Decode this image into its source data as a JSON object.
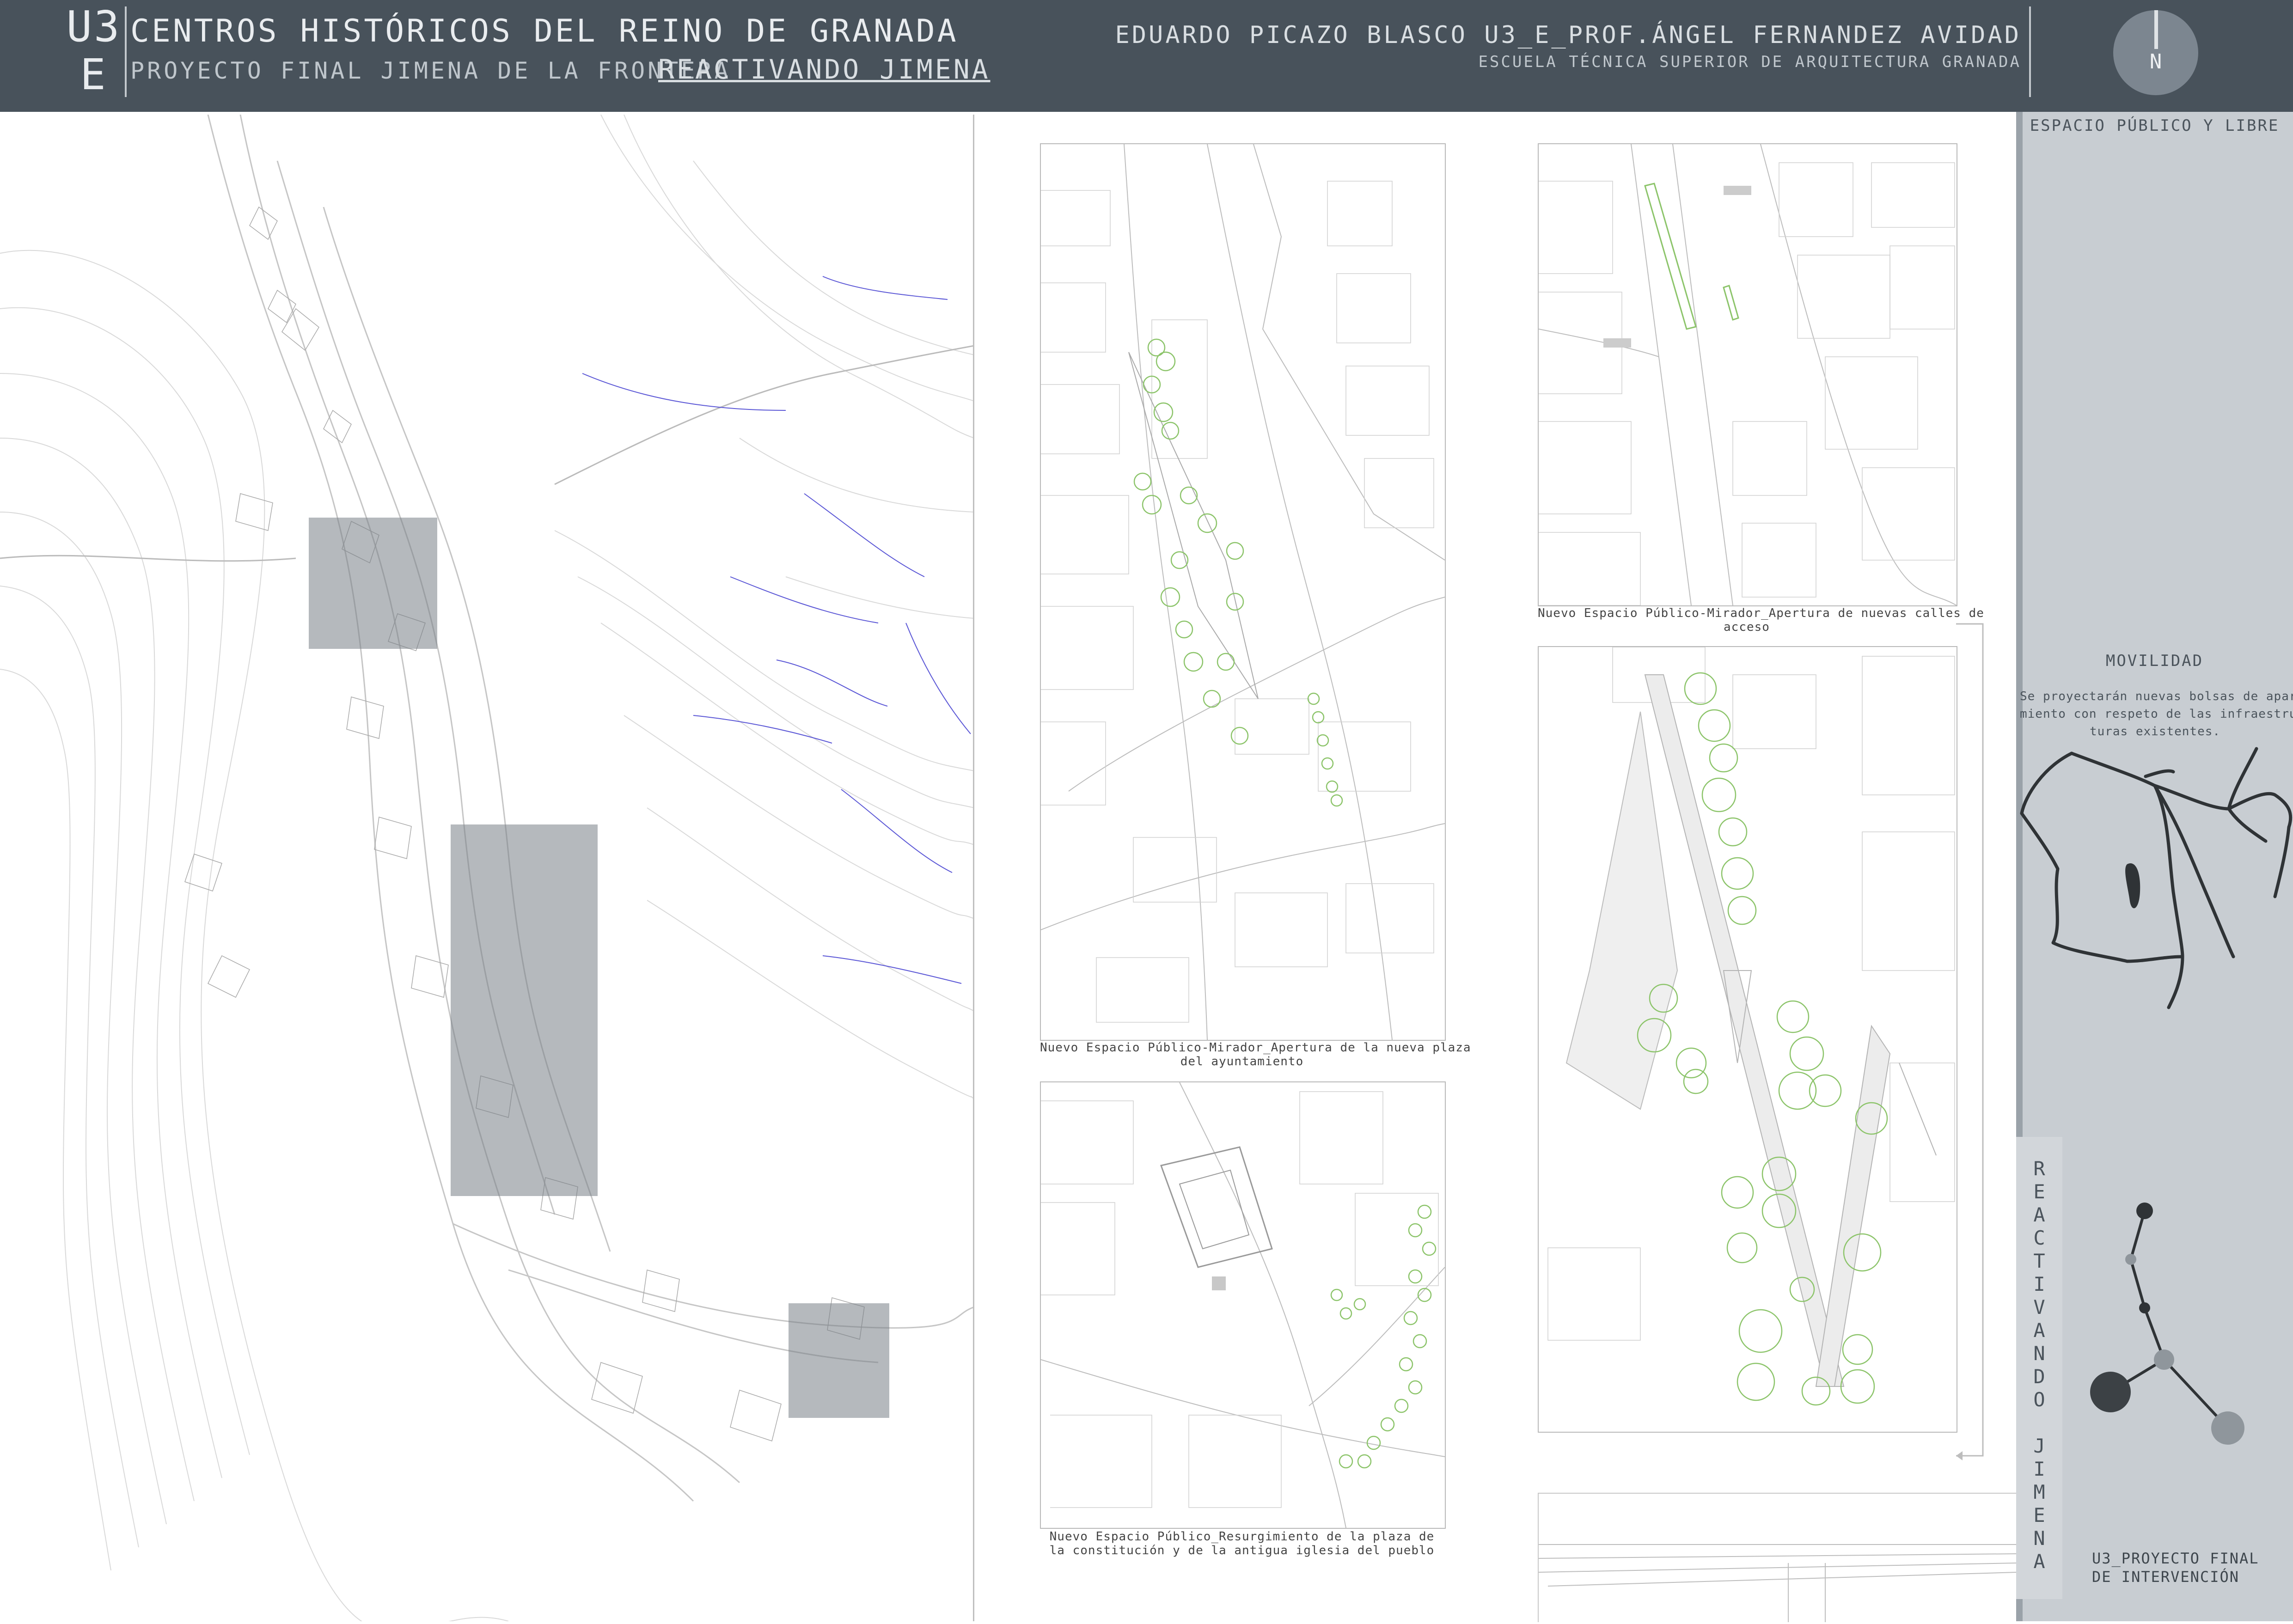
{
  "header": {
    "unit_code": "U3\nE",
    "title": "CENTROS HISTÓRICOS DEL REINO DE GRANADA",
    "subtitle": "PROYECTO FINAL JIMENA DE LA FRONTERA",
    "subtitle_link": "REACTIVANDO JIMENA",
    "author": "EDUARDO PICAZO BLASCO U3_E_PROF.ÁNGEL FERNANDEZ AVIDAD",
    "school": "ESCUELA TÉCNICA SUPERIOR DE ARQUITECTURA GRANADA",
    "north_label": "N"
  },
  "sidebar": {
    "section_1": "ESPACIO PÚBLICO Y LIBRE",
    "section_2": "MOVILIDAD",
    "section_2_text": "Se proyectarán nuevas bolsas de aparca-\nmiento con respeto de las infraestruc-\nturas existentes.",
    "vertical_text": [
      "R",
      "E",
      "A",
      "C",
      "T",
      "I",
      "V",
      "A",
      "N",
      "D",
      "O",
      "",
      "J",
      "I",
      "M",
      "E",
      "N",
      "A"
    ],
    "footer_label": "U3_PROYECTO FINAL\nDE INTERVENCIÓN"
  },
  "captions": {
    "plaza_ayuntamiento": "Nuevo Espacio Público-Mirador_Apertura de la nueva plaza\ndel ayuntamiento",
    "nuevas_calles": "Nuevo Espacio Público-Mirador_Apertura de nuevas calles de\nacceso",
    "plaza_constitucion": "Nuevo Espacio Público_Resurgimiento de la plaza de\nla constitución y de la antigua iglesia del pueblo"
  },
  "colors": {
    "header_bg": "#48525b",
    "sidebar_bg": "#c8cdd2",
    "highlight_grey": "#8a9096",
    "tree_green": "#8cc46a",
    "river_blue": "#5b57d6"
  }
}
